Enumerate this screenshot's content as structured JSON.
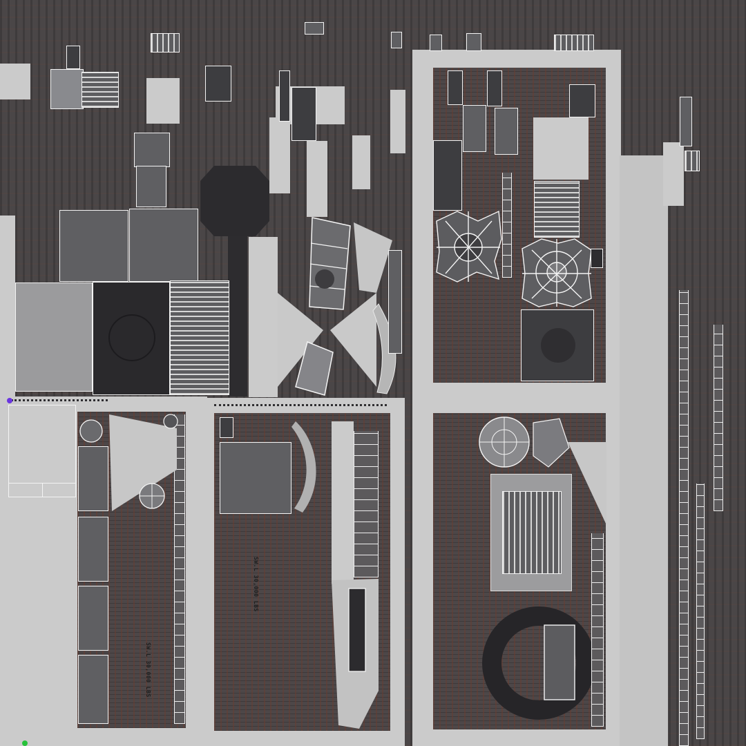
{
  "colors": {
    "concrete": "#cbcbcb",
    "rusted_metal": "#4a4647",
    "dark_metal": "#2d2c2f",
    "uv_wire": "#f4f4f4",
    "marker_violet": "#6a35e0",
    "marker_green": "#27c23a"
  },
  "stencils": {
    "pad_left": "SW.L 30,000 LBS",
    "pad_center": "SW.L 30,000 LBS"
  },
  "markers": [
    "violet-dot",
    "green-dot"
  ]
}
